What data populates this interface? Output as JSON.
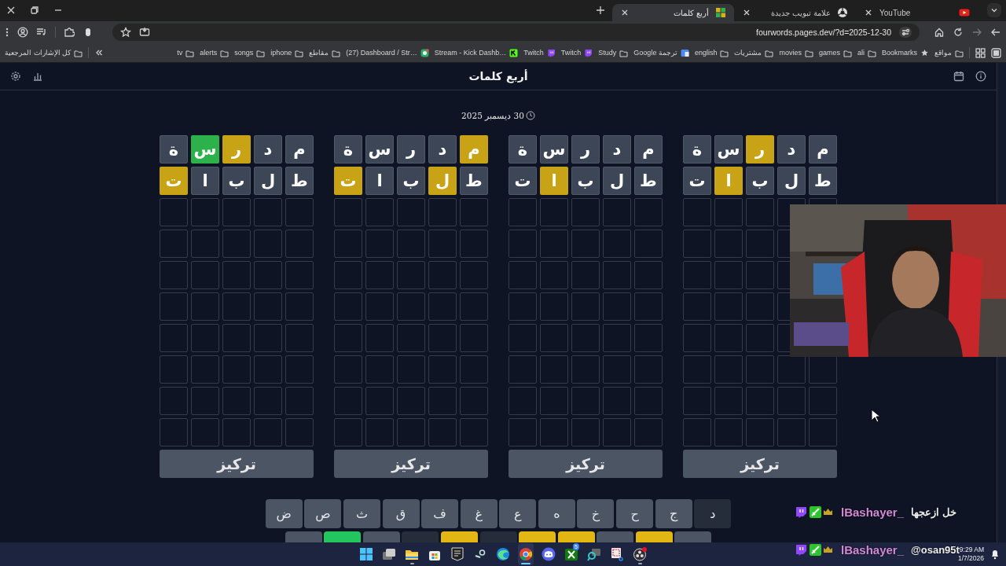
{
  "browser": {
    "tabs": [
      {
        "title": "YouTube",
        "kind": "video",
        "selected": false
      },
      {
        "title": "علامة تبويب جديدة",
        "kind": "newtab",
        "selected": false
      },
      {
        "title": "أربع كلمات",
        "kind": "game",
        "selected": true
      }
    ],
    "address": {
      "url": "fourwords.pages.dev/?d=2025-12-30"
    },
    "bookmarks": [
      {
        "label": "مواقع",
        "kind": "folder"
      },
      {
        "label": "Bookmarks",
        "kind": "star"
      },
      {
        "label": "ali",
        "kind": "folder"
      },
      {
        "label": "games",
        "kind": "folder"
      },
      {
        "label": "movies",
        "kind": "folder"
      },
      {
        "label": "مشتريات",
        "kind": "folder"
      },
      {
        "label": "english",
        "kind": "folder"
      },
      {
        "label": "ترجمة Google",
        "kind": "translate"
      },
      {
        "label": "Study",
        "kind": "folder"
      },
      {
        "label": "Twitch",
        "kind": "twitch"
      },
      {
        "label": "Twitch",
        "kind": "twitch"
      },
      {
        "label": "Stream - Kick Dashb…",
        "kind": "kick"
      },
      {
        "label": "(27) Dashboard / Str…",
        "kind": "dashboard"
      },
      {
        "label": "مقاطع",
        "kind": "folder"
      },
      {
        "label": "iphone",
        "kind": "folder"
      },
      {
        "label": "songs",
        "kind": "folder"
      },
      {
        "label": "alerts",
        "kind": "folder"
      },
      {
        "label": "tv",
        "kind": "folder"
      }
    ],
    "all_bookmarks": "كل الإشارات المرجعية"
  },
  "game": {
    "title": "أربع كلمات",
    "date": "30 ديسمبر 2025",
    "boards": [
      {
        "focus_button": "تركيز",
        "rows": [
          {
            "kind": "guess",
            "cells": [
              {
                "letter": "م",
                "present": false,
                "correct": false
              },
              {
                "letter": "د",
                "present": false,
                "correct": false
              },
              {
                "letter": "ر",
                "present": true,
                "correct": false
              },
              {
                "letter": "س",
                "present": false,
                "correct": false
              },
              {
                "letter": "ة",
                "present": false,
                "correct": false
              }
            ]
          },
          {
            "kind": "guess",
            "cells": [
              {
                "letter": "ط",
                "present": false,
                "correct": false
              },
              {
                "letter": "ل",
                "present": false,
                "correct": false
              },
              {
                "letter": "ب",
                "present": false,
                "correct": false
              },
              {
                "letter": "ا",
                "present": true,
                "correct": false
              },
              {
                "letter": "ت",
                "present": false,
                "correct": false
              }
            ]
          },
          {
            "kind": "empty"
          },
          {
            "kind": "empty_covered"
          },
          {
            "kind": "empty_covered"
          },
          {
            "kind": "empty_covered"
          },
          {
            "kind": "empty_covered"
          },
          {
            "kind": "empty"
          },
          {
            "kind": "empty"
          },
          {
            "kind": "empty"
          }
        ]
      },
      {
        "focus_button": "تركيز",
        "rows": [
          {
            "kind": "guess",
            "cells": [
              {
                "letter": "م",
                "present": false,
                "correct": false
              },
              {
                "letter": "د",
                "present": false,
                "correct": false
              },
              {
                "letter": "ر",
                "present": false,
                "correct": false
              },
              {
                "letter": "س",
                "present": false,
                "correct": false
              },
              {
                "letter": "ة",
                "present": false,
                "correct": false
              }
            ]
          },
          {
            "kind": "guess",
            "cells": [
              {
                "letter": "ط",
                "present": false,
                "correct": false
              },
              {
                "letter": "ل",
                "present": false,
                "correct": false
              },
              {
                "letter": "ب",
                "present": false,
                "correct": false
              },
              {
                "letter": "ا",
                "present": true,
                "correct": false
              },
              {
                "letter": "ت",
                "present": false,
                "correct": false
              }
            ]
          },
          {
            "kind": "empty"
          },
          {
            "kind": "empty"
          },
          {
            "kind": "empty"
          },
          {
            "kind": "empty"
          },
          {
            "kind": "empty"
          },
          {
            "kind": "empty"
          },
          {
            "kind": "empty"
          },
          {
            "kind": "empty"
          }
        ]
      },
      {
        "focus_button": "تركيز",
        "rows": [
          {
            "kind": "guess",
            "cells": [
              {
                "letter": "م",
                "present": true,
                "correct": false
              },
              {
                "letter": "د",
                "present": false,
                "correct": false
              },
              {
                "letter": "ر",
                "present": false,
                "correct": false
              },
              {
                "letter": "س",
                "present": false,
                "correct": false
              },
              {
                "letter": "ة",
                "present": false,
                "correct": false
              }
            ]
          },
          {
            "kind": "guess",
            "cells": [
              {
                "letter": "ط",
                "present": false,
                "correct": false
              },
              {
                "letter": "ل",
                "present": true,
                "correct": false
              },
              {
                "letter": "ب",
                "present": false,
                "correct": false
              },
              {
                "letter": "ا",
                "present": false,
                "correct": false
              },
              {
                "letter": "ت",
                "present": true,
                "correct": false
              }
            ]
          },
          {
            "kind": "empty"
          },
          {
            "kind": "empty"
          },
          {
            "kind": "empty"
          },
          {
            "kind": "empty"
          },
          {
            "kind": "empty"
          },
          {
            "kind": "empty"
          },
          {
            "kind": "empty"
          },
          {
            "kind": "empty"
          }
        ]
      },
      {
        "focus_button": "تركيز",
        "rows": [
          {
            "kind": "guess",
            "cells": [
              {
                "letter": "م",
                "present": false,
                "correct": false
              },
              {
                "letter": "د",
                "present": false,
                "correct": false
              },
              {
                "letter": "ر",
                "present": true,
                "correct": false
              },
              {
                "letter": "س",
                "present": false,
                "correct": true
              },
              {
                "letter": "ة",
                "present": false,
                "correct": false
              }
            ]
          },
          {
            "kind": "guess",
            "cells": [
              {
                "letter": "ط",
                "present": false,
                "correct": false
              },
              {
                "letter": "ل",
                "present": false,
                "correct": false
              },
              {
                "letter": "ب",
                "present": false,
                "correct": false
              },
              {
                "letter": "ا",
                "present": false,
                "correct": false
              },
              {
                "letter": "ت",
                "present": true,
                "correct": false
              }
            ]
          },
          {
            "kind": "empty"
          },
          {
            "kind": "empty"
          },
          {
            "kind": "empty"
          },
          {
            "kind": "empty"
          },
          {
            "kind": "empty"
          },
          {
            "kind": "empty"
          },
          {
            "kind": "empty"
          },
          {
            "kind": "empty"
          }
        ]
      }
    ],
    "keyboard": {
      "rows": [
        {
          "keys": [
            {
              "letter": "د",
              "used": true,
              "present": false,
              "correct": false
            },
            {
              "letter": "ج",
              "used": false,
              "present": false,
              "correct": false
            },
            {
              "letter": "ح",
              "used": false,
              "present": false,
              "correct": false
            },
            {
              "letter": "خ",
              "used": false,
              "present": false,
              "correct": false
            },
            {
              "letter": "ه",
              "used": false,
              "present": false,
              "correct": false
            },
            {
              "letter": "ع",
              "used": false,
              "present": false,
              "correct": false
            },
            {
              "letter": "غ",
              "used": false,
              "present": false,
              "correct": false
            },
            {
              "letter": "ف",
              "used": false,
              "present": false,
              "correct": false
            },
            {
              "letter": "ق",
              "used": false,
              "present": false,
              "correct": false
            },
            {
              "letter": "ث",
              "used": false,
              "present": false,
              "correct": false
            },
            {
              "letter": "ص",
              "used": false,
              "present": false,
              "correct": false
            },
            {
              "letter": "ض",
              "used": false,
              "present": false,
              "correct": false
            }
          ]
        },
        {
          "keys": [
            {
              "used": false,
              "present": false,
              "correct": false
            },
            {
              "used": true,
              "present": true,
              "correct": false
            },
            {
              "used": false,
              "present": false,
              "correct": false
            },
            {
              "used": true,
              "present": true,
              "correct": false
            },
            {
              "used": true,
              "present": true,
              "correct": false
            },
            {
              "used": true,
              "present": false,
              "correct": false
            },
            {
              "used": true,
              "present": true,
              "correct": false
            },
            {
              "used": true,
              "present": false,
              "correct": false
            },
            {
              "used": false,
              "present": false,
              "correct": false
            },
            {
              "used": true,
              "present": false,
              "correct": true
            },
            {
              "used": false,
              "present": false,
              "correct": false
            }
          ]
        }
      ]
    }
  },
  "chat": {
    "messages": [
      {
        "user": "lBashayer_",
        "text": "خل ازعجها"
      },
      {
        "user": "lBashayer_",
        "text": "@osan95t"
      }
    ]
  },
  "taskbar": {
    "apps": [
      {
        "kind": "start",
        "running": false,
        "selected": false
      },
      {
        "kind": "taskview",
        "running": false,
        "selected": false
      },
      {
        "kind": "files",
        "running": true,
        "selected": false
      },
      {
        "kind": "store",
        "running": false,
        "selected": false
      },
      {
        "kind": "epic",
        "running": false,
        "selected": false
      },
      {
        "kind": "steam",
        "running": false,
        "selected": false
      },
      {
        "kind": "edge",
        "running": false,
        "selected": false
      },
      {
        "kind": "chrome",
        "running": true,
        "selected": true
      },
      {
        "kind": "discord",
        "running": false,
        "selected": false
      },
      {
        "kind": "xbox",
        "running": false,
        "selected": false,
        "badge": "5"
      },
      {
        "kind": "magnifier",
        "running": false,
        "selected": false
      },
      {
        "kind": "snip",
        "running": false,
        "selected": false
      },
      {
        "kind": "obs",
        "running": true,
        "selected": false
      }
    ],
    "clock": {
      "time": "9:29 AM",
      "date": "1/7/2026"
    }
  }
}
